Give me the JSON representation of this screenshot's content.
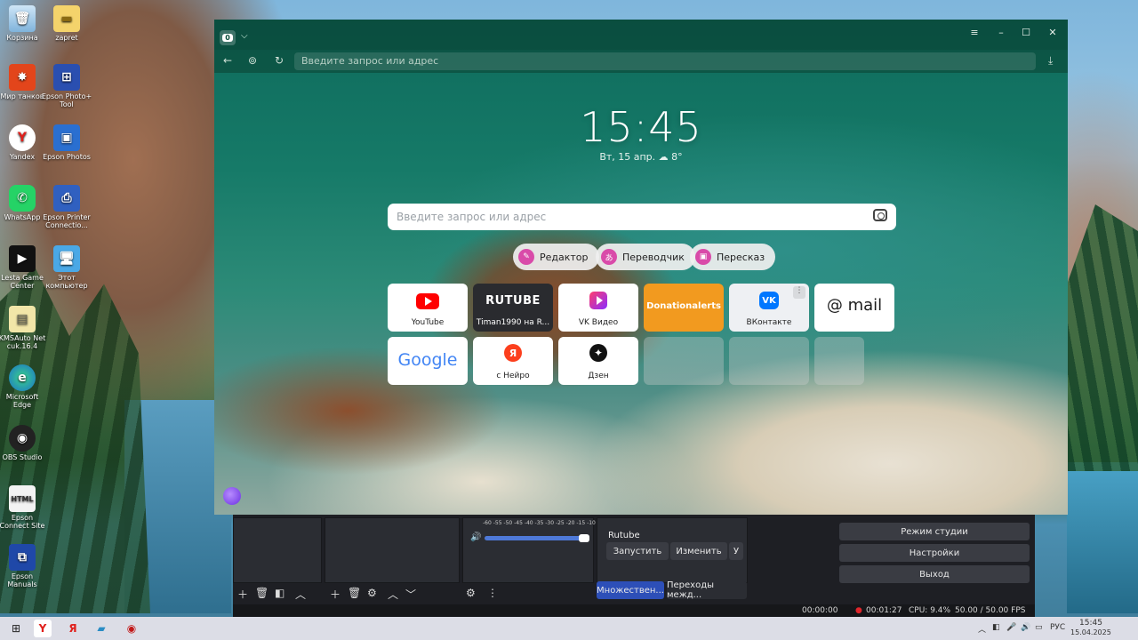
{
  "desktop_icons": [
    {
      "label": "Корзина",
      "icon": "recycle-bin-icon"
    },
    {
      "label": "zapret",
      "icon": "folder-icon"
    },
    {
      "label": "Мир танков",
      "icon": "tanks-icon"
    },
    {
      "label": "Epson Photo+ Tool",
      "icon": "epson-icon"
    },
    {
      "label": "Yandex",
      "icon": "yandex-icon"
    },
    {
      "label": "Epson Photos",
      "icon": "epson-photos-icon"
    },
    {
      "label": "WhatsApp",
      "icon": "whatsapp-icon"
    },
    {
      "label": "Epson Printer Connectio...",
      "icon": "epson-printer-icon"
    },
    {
      "label": "Lesta Game Center",
      "icon": "lesta-icon"
    },
    {
      "label": "Этот компьютер",
      "icon": "computer-icon"
    },
    {
      "label": "KMSAuto Net cuk.16.4",
      "icon": "kmsauto-icon"
    },
    {
      "label": "Microsoft Edge",
      "icon": "edge-icon"
    },
    {
      "label": "OBS Studio",
      "icon": "obs-icon"
    },
    {
      "label": "Epson Connect Site",
      "icon": "html-file-icon"
    },
    {
      "label": "Epson Manuals",
      "icon": "manuals-icon"
    }
  ],
  "browser": {
    "tab_count": "0",
    "address_placeholder": "Введите запрос или адрес",
    "window_controls": {
      "menu": "≡",
      "minimize": "–",
      "maximize": "☐",
      "close": "✕"
    },
    "clock": "15:45",
    "date": "Вт, 15 апр. ☁ 8°",
    "search_placeholder": "Введите запрос или адрес",
    "quick_actions": [
      {
        "label": "Редактор"
      },
      {
        "label": "Переводчик"
      },
      {
        "label": "Пересказ"
      }
    ],
    "tiles_row1": [
      {
        "label": "YouTube"
      },
      {
        "label": "Timan1990 на R...",
        "logo_text": "RUTUBE"
      },
      {
        "label": "VK Видео"
      },
      {
        "label": "Donationalerts"
      },
      {
        "label": "ВКонтакте"
      },
      {
        "label": "",
        "logo_text": "@ mail"
      }
    ],
    "tiles_row2": [
      {
        "label": "",
        "logo_text": "Google"
      },
      {
        "label": "с Нейро",
        "logo_text": "Я"
      },
      {
        "label": "Дзен"
      }
    ]
  },
  "obs": {
    "meter_scale": "-60 -55 -50 -45 -40 -35 -30 -25 -20 -15 -10 -5 0",
    "stream_target": "Rutube",
    "start_button": "Запустить",
    "edit_button": "Изменить",
    "edit_extra": "У",
    "tab_multiple": "Множествен...",
    "tab_transitions": "Переходы межд...",
    "studio_mode": "Режим студии",
    "settings": "Настройки",
    "exit": "Выход",
    "status": {
      "rec_time1": "00:00:00",
      "rec_time2": "00:01:27",
      "cpu": "CPU: 9.4%",
      "fps": "50.00 / 50.00 FPS"
    }
  },
  "taskbar": {
    "lang": "РУС",
    "time": "15:45",
    "date": "15.04.2025"
  },
  "colors": {
    "donation": "#f29a1f",
    "youtube": "#ff0000",
    "vk": "#0077ff",
    "obs_active_tab": "#2d4fb8",
    "obs_bg": "#1e1f24"
  }
}
